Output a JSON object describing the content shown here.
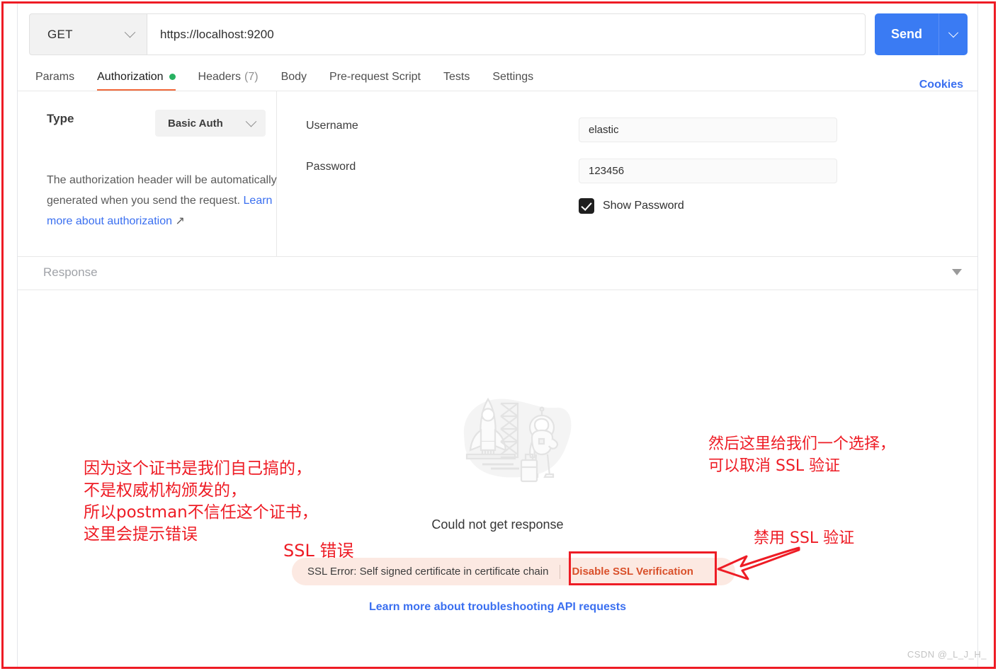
{
  "request_bar": {
    "method": "GET",
    "method_caret_icon": "chevron-down-icon",
    "url": "https://localhost:9200",
    "url_placeholder": "Enter request URL",
    "send_label": "Send",
    "send_caret_icon": "chevron-down-icon"
  },
  "tabs": {
    "items": [
      {
        "label": "Params",
        "active": false,
        "badge": ""
      },
      {
        "label": "Authorization",
        "active": true,
        "badge": "",
        "dot": true
      },
      {
        "label": "Headers",
        "active": false,
        "badge": "(7)"
      },
      {
        "label": "Body",
        "active": false,
        "badge": ""
      },
      {
        "label": "Pre-request Script",
        "active": false,
        "badge": ""
      },
      {
        "label": "Tests",
        "active": false,
        "badge": ""
      },
      {
        "label": "Settings",
        "active": false,
        "badge": ""
      }
    ],
    "cookies_label": "Cookies"
  },
  "authorization": {
    "type_label": "Type",
    "type_value": "Basic Auth",
    "type_caret_icon": "chevron-down-icon",
    "description_part1": "The authorization header will be automatically generated when you send the request. ",
    "description_link": "Learn more about authorization",
    "description_link_icon": "external-link-arrow-icon",
    "username_label": "Username",
    "username_value": "elastic",
    "username_placeholder": "Username",
    "password_label": "Password",
    "password_value": "123456",
    "password_placeholder": "Password",
    "show_password_label": "Show Password",
    "show_password_checked": true
  },
  "response": {
    "title": "Response",
    "collapse_icon": "caret-down-icon",
    "illustration_name": "rocket-launch-astronaut-illustration",
    "empty_message": "Could not get response",
    "error_text": "SSL Error: Self signed certificate in certificate chain",
    "disable_ssl_label": "Disable SSL Verification",
    "learn_more_label": "Learn more about troubleshooting API requests"
  },
  "annotations": {
    "accent_color": "#ee1c25",
    "left_note": "因为这个证书是我们自己搞的，\n不是权威机构颁发的，\n所以postman不信任这个证书，\n这里会提示错误",
    "ssl_error_note": "SSL 错误",
    "right_note": "然后这里给我们一个选择，\n可以取消 SSL 验证",
    "disable_note": "禁用 SSL 验证",
    "arrow_icon": "left-arrow-annotation-icon",
    "highlight_box_name": "disable-ssl-highlight-box"
  },
  "watermark": "CSDN @_L_J_H_"
}
